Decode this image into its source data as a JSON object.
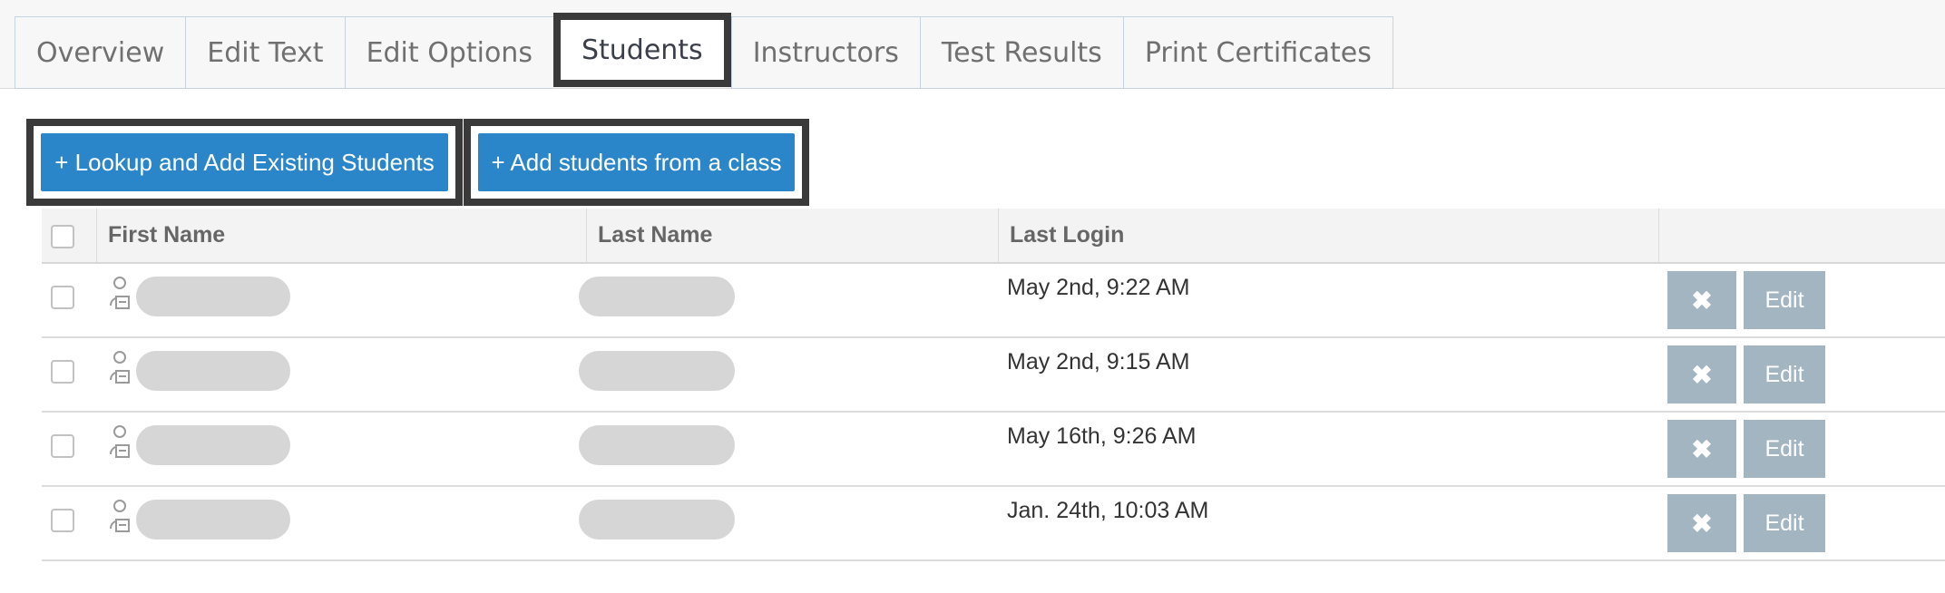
{
  "tabs": [
    {
      "label": "Overview"
    },
    {
      "label": "Edit Text"
    },
    {
      "label": "Edit Options"
    },
    {
      "label": "Students"
    },
    {
      "label": "Instructors"
    },
    {
      "label": "Test Results"
    },
    {
      "label": "Print Certificates"
    }
  ],
  "active_tab": "Students",
  "actions": {
    "lookup_label": "+ Lookup and Add Existing Students",
    "add_class_label": "+ Add students from a class"
  },
  "table": {
    "headers": {
      "first_name": "First Name",
      "last_name": "Last Name",
      "last_login": "Last Login"
    },
    "rows": [
      {
        "last_login": "May 2nd, 9:22 AM",
        "delete_icon": "✖",
        "edit_label": "Edit"
      },
      {
        "last_login": "May 2nd, 9:15 AM",
        "delete_icon": "✖",
        "edit_label": "Edit"
      },
      {
        "last_login": "May 16th, 9:26 AM",
        "delete_icon": "✖",
        "edit_label": "Edit"
      },
      {
        "last_login": "Jan. 24th, 10:03 AM",
        "delete_icon": "✖",
        "edit_label": "Edit"
      }
    ]
  },
  "colors": {
    "primary_button": "#2a86c8",
    "row_action_button": "#a4b5c2",
    "highlight_border": "#3a3a3a"
  }
}
